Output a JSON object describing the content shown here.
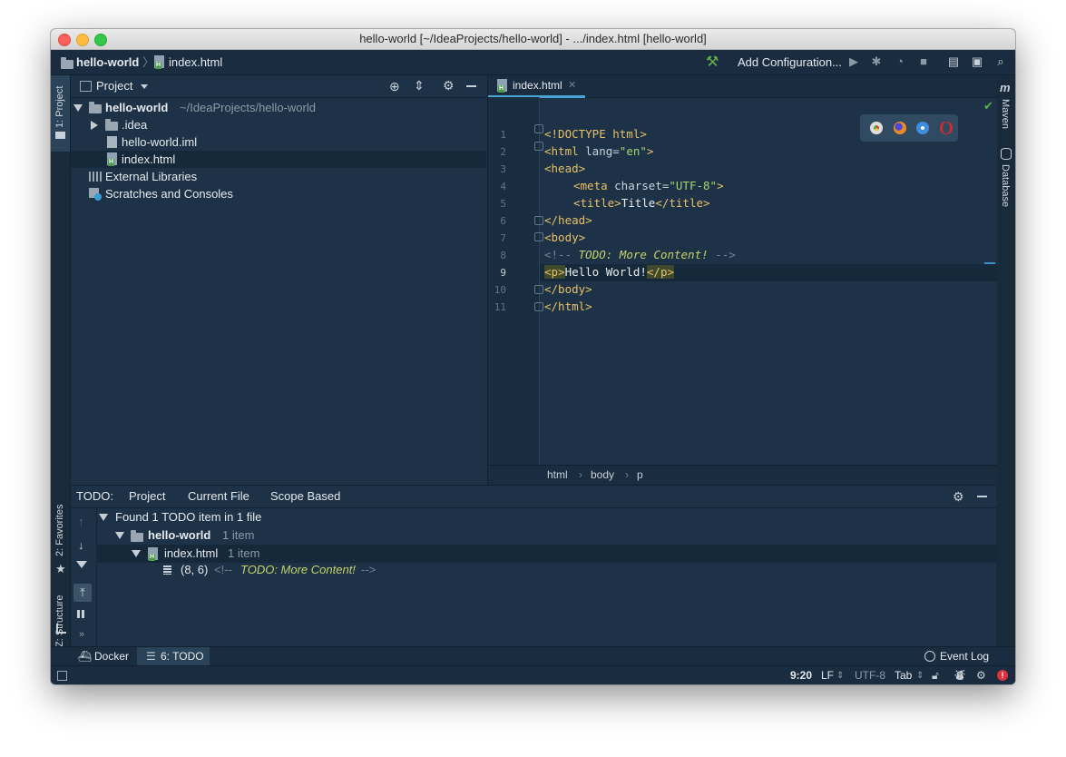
{
  "window": {
    "title": "hello-world [~/IdeaProjects/hello-world] - .../index.html [hello-world]"
  },
  "navbar": {
    "project_crumb": "hello-world",
    "file_crumb": "index.html",
    "add_configuration": "Add Configuration..."
  },
  "left_stripe": {
    "project": "1: Project",
    "favorites": "2: Favorites",
    "structure": "Z: Structure"
  },
  "right_stripe": {
    "maven": "Maven",
    "database": "Database"
  },
  "project_panel": {
    "title": "Project",
    "tree": [
      {
        "label": "hello-world",
        "detail": "~/IdeaProjects/hello-world"
      },
      {
        "label": ".idea"
      },
      {
        "label": "hello-world.iml"
      },
      {
        "label": "index.html"
      },
      {
        "label": "External Libraries"
      },
      {
        "label": "Scratches and Consoles"
      }
    ]
  },
  "editor": {
    "tab_label": "index.html",
    "line_numbers": [
      "1",
      "2",
      "3",
      "4",
      "5",
      "6",
      "7",
      "8",
      "9",
      "10",
      "11"
    ],
    "lines": [
      {
        "t1": "<!DOCTYPE html>"
      },
      {
        "t1": "<html ",
        "a1": "lang=",
        "s1": "\"en\"",
        "t2": ">"
      },
      {
        "t1": "<head>"
      },
      {
        "t1": "<meta ",
        "a1": "charset=",
        "s1": "\"UTF-8\"",
        "t2": ">"
      },
      {
        "t1": "<title>",
        "x": "Title",
        "t2": "</title>"
      },
      {
        "t1": "</head>"
      },
      {
        "t1": "<body>"
      },
      {
        "c1": "<!-- ",
        "todo": "TODO: More Content!",
        "c2": " -->"
      },
      {
        "t1": "<p>",
        "x": "Hello World!",
        "t2": "</p>"
      },
      {
        "t1": "</body>"
      },
      {
        "t1": "</html>"
      }
    ],
    "breadcrumb": [
      "html",
      "body",
      "p"
    ]
  },
  "todo_panel": {
    "label": "TODO:",
    "tabs": [
      "Project",
      "Current File",
      "Scope Based"
    ],
    "summary": "Found 1 TODO item in 1 file",
    "module": "hello-world",
    "module_count": "1 item",
    "file": "index.html",
    "file_count": "1 item",
    "item_pos": "(8, 6)",
    "item_prefix": "<!-- ",
    "item_todo": "TODO: More Content!",
    "item_suffix": " -->"
  },
  "bottom_tabs": {
    "docker": "Docker",
    "todo": "6: TODO",
    "event_log": "Event Log"
  },
  "status": {
    "position": "9:20",
    "line_sep": "LF",
    "encoding": "UTF-8",
    "indent": "Tab"
  },
  "colors": {
    "background": "#1d3246",
    "tag": "#e6c069",
    "string": "#a5d66e",
    "todo": "#c5d26a",
    "accent": "#4aa3d6"
  }
}
